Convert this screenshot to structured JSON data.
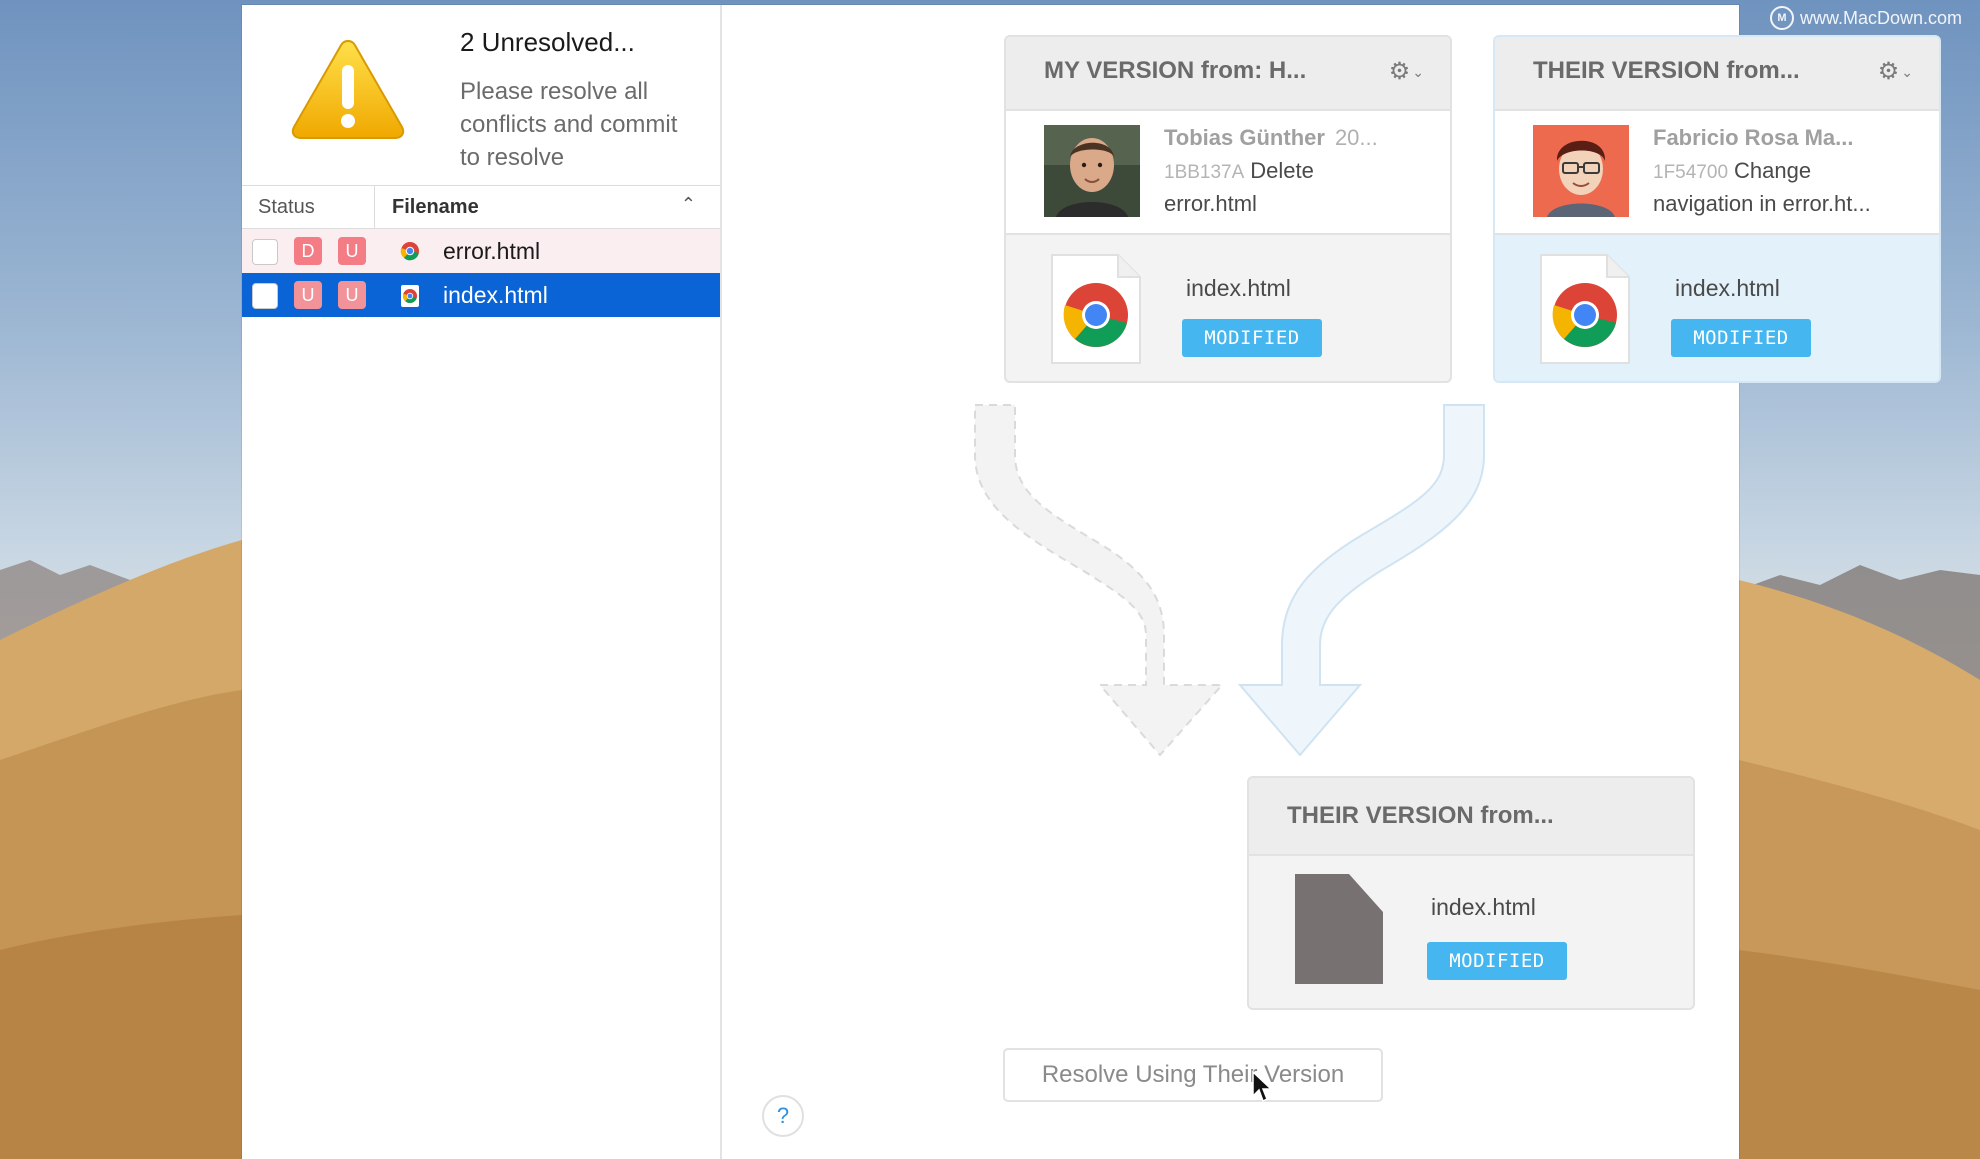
{
  "watermark": "www.MacDown.com",
  "alert": {
    "title": "2 Unresolved...",
    "message": "Please resolve all conflicts and commit to resolve",
    "icon": "warning-icon"
  },
  "file_list": {
    "columns": {
      "status": "Status",
      "filename": "Filename"
    },
    "rows": [
      {
        "badges": [
          "D",
          "U"
        ],
        "name": "error.html",
        "selected": false
      },
      {
        "badges": [
          "U",
          "U"
        ],
        "name": "index.html",
        "selected": true
      }
    ]
  },
  "my_version": {
    "title": "MY VERSION from: H...",
    "author": "Tobias Günther",
    "date": "20...",
    "hash": "1BB137A",
    "message": "Delete error.html",
    "file": "index.html",
    "status": "MODIFIED"
  },
  "their_version": {
    "title": "THEIR VERSION from...",
    "author": "Fabricio Rosa Ma...",
    "hash": "1F54700",
    "message": "Change navigation in error.ht...",
    "file": "index.html",
    "status": "MODIFIED"
  },
  "result": {
    "title": "THEIR VERSION from...",
    "file": "index.html",
    "status": "MODIFIED"
  },
  "resolve_button": "Resolve Using Their Version",
  "help_button": "?",
  "colors": {
    "selection": "#0b64d6",
    "badge": "#f47c84",
    "modified": "#45b6ef",
    "their_highlight": "#e3f1fb"
  }
}
